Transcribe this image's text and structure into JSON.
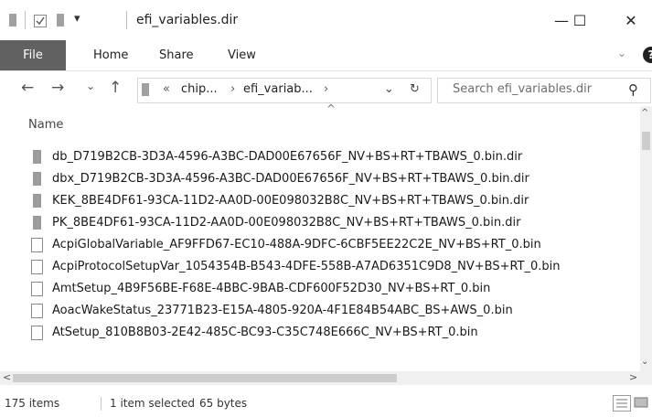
{
  "window": {
    "title": "efi_variables.dir",
    "minimize_glyph": "—",
    "maximize_glyph": "☐",
    "close_glyph": "✕",
    "qat_dropdown_glyph": "▾"
  },
  "ribbon": {
    "tabs": [
      "File",
      "Home",
      "Share",
      "View"
    ],
    "expand_glyph": "⌄",
    "help_glyph": "?"
  },
  "nav": {
    "back_glyph": "←",
    "forward_glyph": "→",
    "recent_glyph": "⌄",
    "up_glyph": "↑",
    "overflow_glyph": "«",
    "crumbs": [
      "chip...",
      "efi_variab..."
    ],
    "crumb_sep": "›",
    "address_dropdown_glyph": "⌄",
    "refresh_glyph": "↻"
  },
  "search": {
    "placeholder": "Search efi_variables.dir",
    "icon_glyph": "⚲"
  },
  "columns": {
    "name": "Name",
    "sort_glyph": "^"
  },
  "files": [
    {
      "name": "db_D719B2CB-3D3A-4596-A3BC-DAD00E67656F_NV+BS+RT+TBAWS_0.bin.dir",
      "type": "folder"
    },
    {
      "name": "dbx_D719B2CB-3D3A-4596-A3BC-DAD00E67656F_NV+BS+RT+TBAWS_0.bin.dir",
      "type": "folder"
    },
    {
      "name": "KEK_8BE4DF61-93CA-11D2-AA0D-00E098032B8C_NV+BS+RT+TBAWS_0.bin.dir",
      "type": "folder"
    },
    {
      "name": "PK_8BE4DF61-93CA-11D2-AA0D-00E098032B8C_NV+BS+RT+TBAWS_0.bin.dir",
      "type": "folder"
    },
    {
      "name": "AcpiGlobalVariable_AF9FFD67-EC10-488A-9DFC-6CBF5EE22C2E_NV+BS+RT_0.bin",
      "type": "file"
    },
    {
      "name": "AcpiProtocolSetupVar_1054354B-B543-4DFE-558B-A7AD6351C9D8_NV+BS+RT_0.bin",
      "type": "file"
    },
    {
      "name": "AmtSetup_4B9F56BE-F68E-4BBC-9BAB-CDF600F52D30_NV+BS+RT_0.bin",
      "type": "file"
    },
    {
      "name": "AoacWakeStatus_23771B23-E15A-4805-920A-4F1E84B54ABC_BS+AWS_0.bin",
      "type": "file"
    },
    {
      "name": "AtSetup_810B8B03-2E42-485C-BC93-C35C748E666C_NV+BS+RT_0.bin",
      "type": "file"
    }
  ],
  "status": {
    "item_count": "175 items",
    "selection": "1 item selected",
    "size": "65 bytes"
  },
  "scroll": {
    "left_glyph": "<",
    "right_glyph": ">",
    "up_glyph": "^",
    "down_glyph": "⌄"
  },
  "colors": {
    "file_tab_bg": "#616161",
    "folder_icon": "#9c9c9c"
  }
}
